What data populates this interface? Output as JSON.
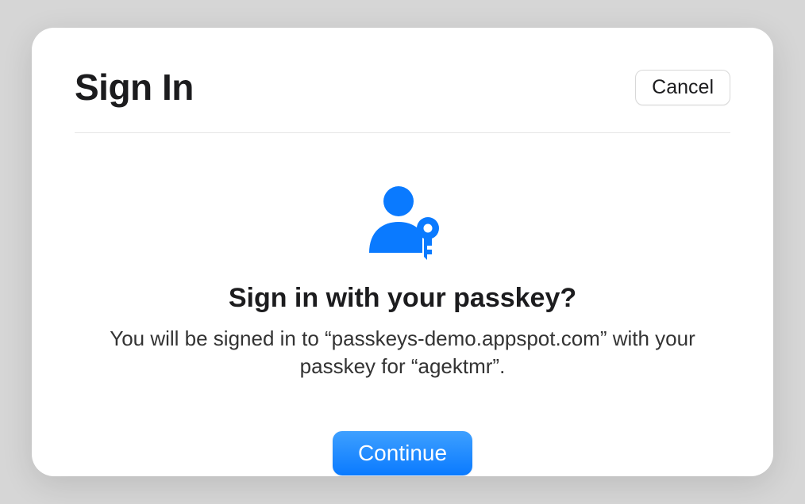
{
  "header": {
    "title": "Sign In",
    "cancel_label": "Cancel"
  },
  "content": {
    "icon": "user-passkey-icon",
    "heading": "Sign in with your passkey?",
    "description": "You will be signed in to “passkeys-demo.appspot.com” with your passkey for “agektmr”.",
    "continue_label": "Continue"
  },
  "colors": {
    "accent": "#0a7aff"
  }
}
